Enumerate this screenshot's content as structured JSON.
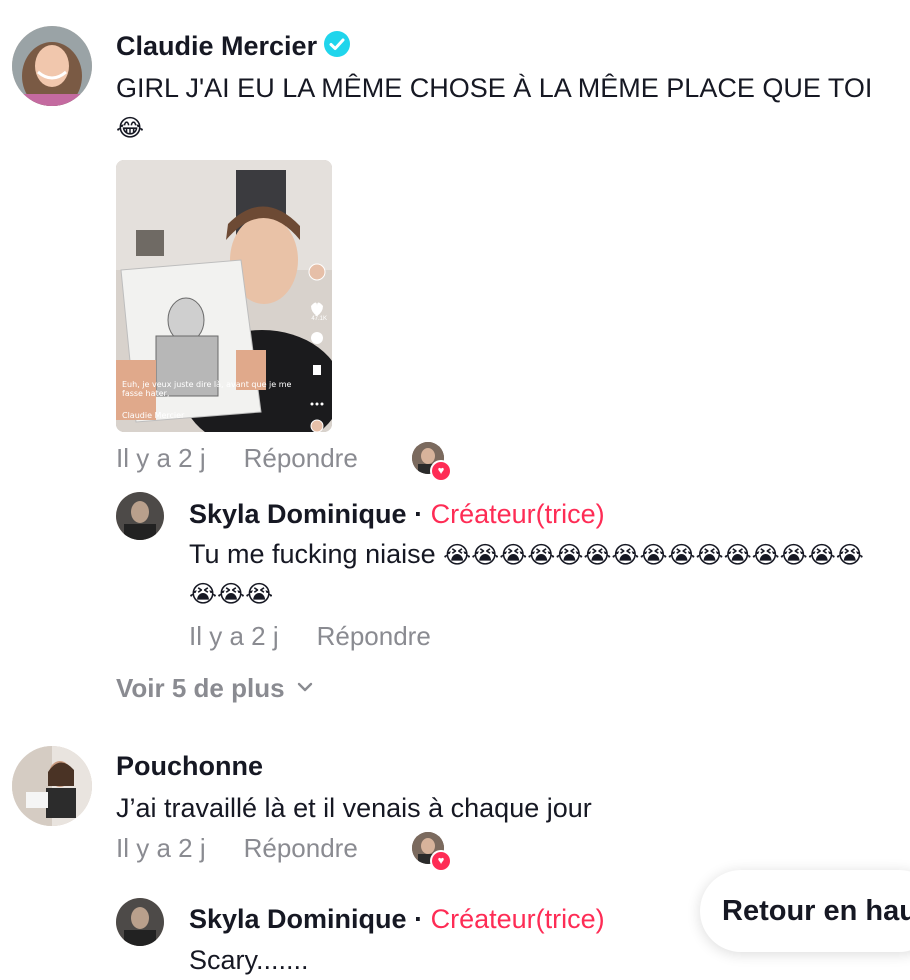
{
  "comments": [
    {
      "author": "Claudie Mercier",
      "verified": true,
      "text": "GIRL J'AI EU LA MÊME CHOSE À LA MÊME PLACE QUE TOI",
      "emoji": "😂",
      "video": {
        "caption": "Euh, je veux juste dire là, avant que je me fasse hater,",
        "author": "Claudie Mercier",
        "likes": "47.1K"
      },
      "time": "Il y a 2 j",
      "reply_label": "Répondre",
      "liked_by_creator": true,
      "replies": [
        {
          "author": "Skyla Dominique",
          "separator": "·",
          "creator_label": "Créateur(trice)",
          "text": "Tu me fucking niaise",
          "emojis_line1": "😭😭😭😭😭😭😭😭😭😭😭😭😭😭😭",
          "emojis_line2": "😭😭😭",
          "time": "Il y a 2 j",
          "reply_label": "Répondre"
        }
      ],
      "view_more": "Voir 5 de plus"
    },
    {
      "author": "Pouchonne",
      "verified": false,
      "text": "J’ai travaillé là et il venais à chaque jour",
      "time": "Il y a 2 j",
      "reply_label": "Répondre",
      "liked_by_creator": true,
      "replies": [
        {
          "author": "Skyla Dominique",
          "separator": "·",
          "creator_label": "Créateur(trice)",
          "text": "Scary.......",
          "time": "",
          "reply_label": ""
        }
      ]
    }
  ],
  "back_to_top": "Retour en haut",
  "colors": {
    "creator_accent": "#fe2c55",
    "verified_blue": "#20d5ec",
    "meta_gray": "#8a8b91",
    "text": "#161823"
  },
  "icons": {
    "verified": "verified-badge-icon",
    "heart": "heart-icon",
    "chevron": "chevron-down-icon"
  }
}
